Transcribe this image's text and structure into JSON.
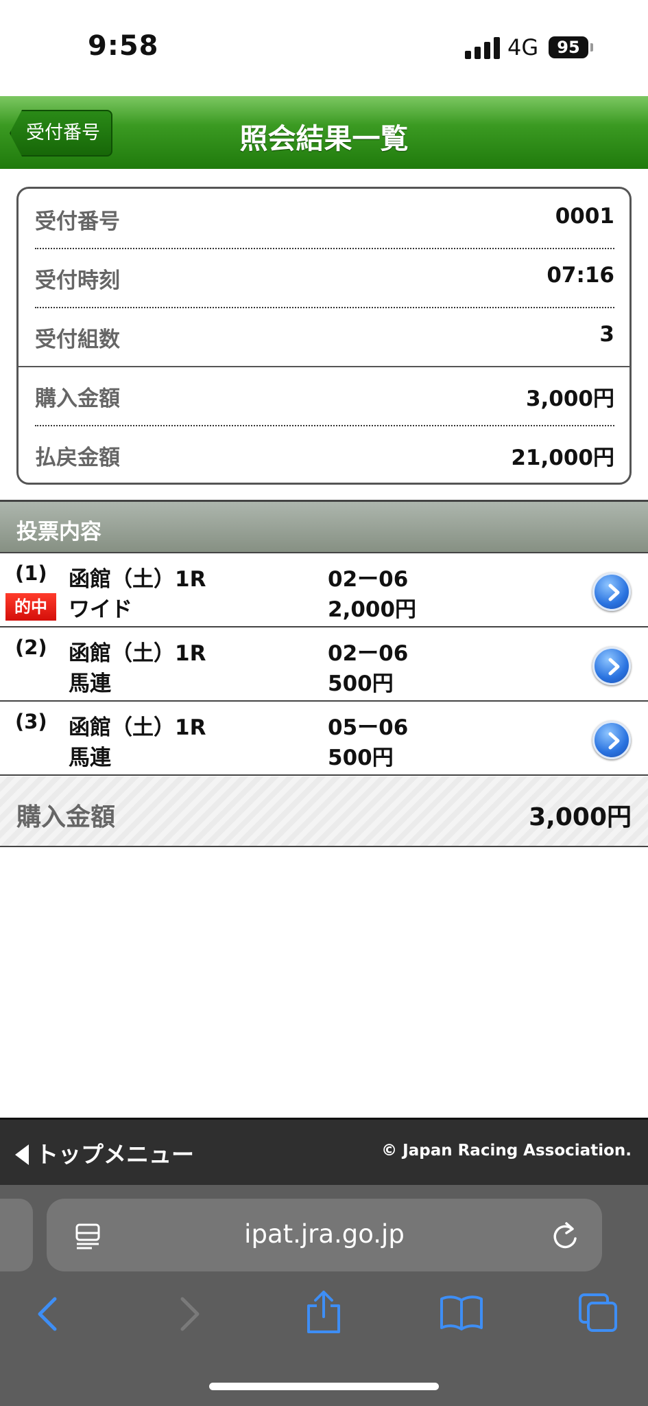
{
  "status_bar": {
    "time": "9:58",
    "network": "4G",
    "battery": "95"
  },
  "header": {
    "back_label": "受付番号",
    "title": "照会結果一覧"
  },
  "summary": {
    "rows": [
      {
        "label": "受付番号",
        "value": "0001"
      },
      {
        "label": "受付時刻",
        "value": "07:16"
      },
      {
        "label": "受付組数",
        "value": "3"
      },
      {
        "label": "購入金額",
        "value": "3,000円"
      },
      {
        "label": "払戻金額",
        "value": "21,000円"
      }
    ]
  },
  "votes": {
    "section_title": "投票内容",
    "hit_label": "的中",
    "items": [
      {
        "index": "(1)",
        "race": "函館（土）1R",
        "type": "ワイド",
        "combo": "02ー06",
        "amount": "2,000円",
        "hit": true
      },
      {
        "index": "(2)",
        "race": "函館（土）1R",
        "type": "馬連",
        "combo": "02ー06",
        "amount": "500円",
        "hit": false
      },
      {
        "index": "(3)",
        "race": "函館（土）1R",
        "type": "馬連",
        "combo": "05ー06",
        "amount": "500円",
        "hit": false
      }
    ]
  },
  "total": {
    "label": "購入金額",
    "value": "3,000円"
  },
  "footer": {
    "top_menu": "トップメニュー",
    "copyright": "© Japan Racing Association."
  },
  "browser": {
    "url": "ipat.jra.go.jp"
  },
  "colors": {
    "header_green": "#1f7a0c",
    "hit_red": "#d40f0a",
    "icon_blue": "#3e8ef5"
  }
}
